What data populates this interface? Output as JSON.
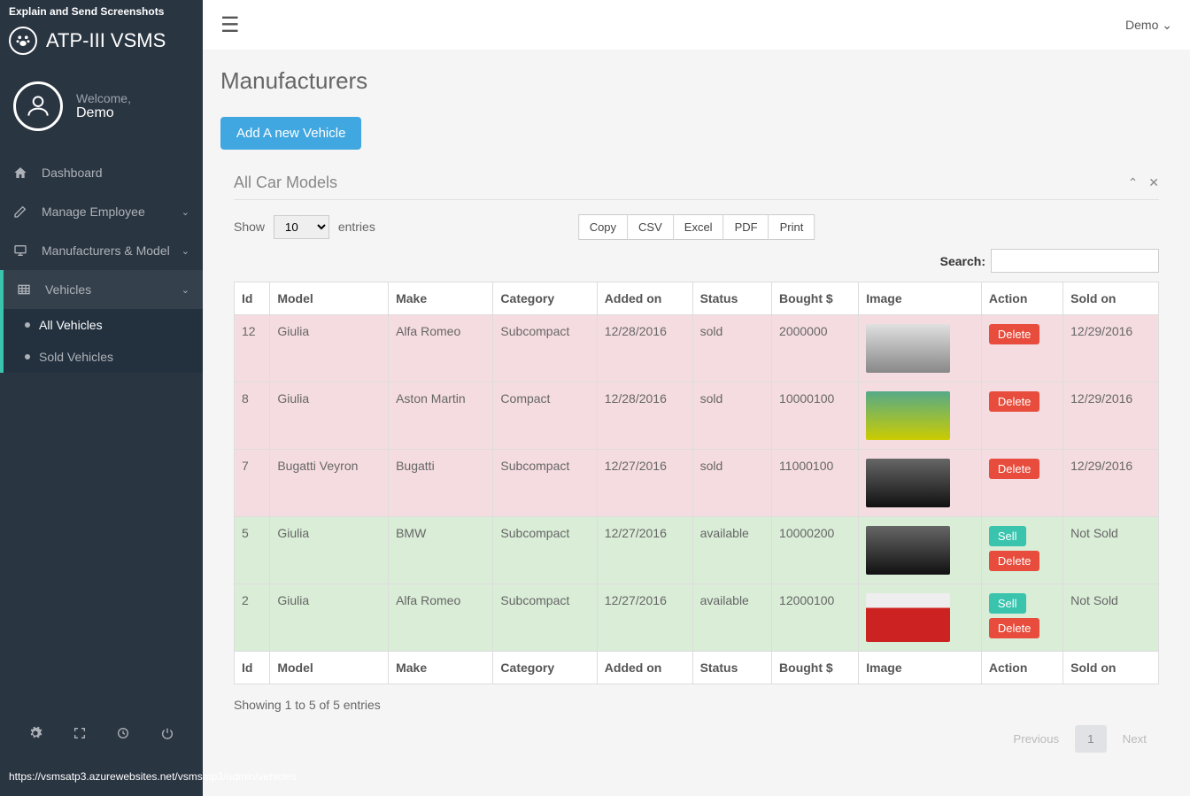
{
  "banner": "Explain and Send Screenshots",
  "app_name": "ATP-III VSMS",
  "welcome_label": "Welcome,",
  "user_name": "Demo",
  "nav": {
    "dashboard": "Dashboard",
    "manage_employee": "Manage Employee",
    "manufacturers_model": "Manufacturers & Model",
    "vehicles": "Vehicles",
    "all_vehicles": "All Vehicles",
    "sold_vehicles": "Sold Vehicles"
  },
  "topbar_user": "Demo",
  "page_title": "Manufacturers",
  "add_button": "Add A new Vehicle",
  "panel_title": "All Car Models",
  "entries": {
    "show": "Show",
    "value": "10",
    "label": "entries"
  },
  "export": {
    "copy": "Copy",
    "csv": "CSV",
    "excel": "Excel",
    "pdf": "PDF",
    "print": "Print"
  },
  "search_label": "Search:",
  "columns": {
    "id": "Id",
    "model": "Model",
    "make": "Make",
    "category": "Category",
    "added_on": "Added on",
    "status": "Status",
    "bought": "Bought $",
    "image": "Image",
    "action": "Action",
    "sold_on": "Sold on"
  },
  "actions": {
    "sell": "Sell",
    "delete": "Delete"
  },
  "rows": [
    {
      "id": "12",
      "model": "Giulia",
      "make": "Alfa Romeo",
      "category": "Subcompact",
      "added_on": "12/28/2016",
      "status": "sold",
      "bought": "2000000",
      "sold_on": "12/29/2016",
      "thumb": "silver"
    },
    {
      "id": "8",
      "model": "Giulia",
      "make": "Aston Martin",
      "category": "Compact",
      "added_on": "12/28/2016",
      "status": "sold",
      "bought": "10000100",
      "sold_on": "12/29/2016",
      "thumb": "yellow"
    },
    {
      "id": "7",
      "model": "Bugatti Veyron",
      "make": "Bugatti",
      "category": "Subcompact",
      "added_on": "12/27/2016",
      "status": "sold",
      "bought": "11000100",
      "sold_on": "12/29/2016",
      "thumb": "black"
    },
    {
      "id": "5",
      "model": "Giulia",
      "make": "BMW",
      "category": "Subcompact",
      "added_on": "12/27/2016",
      "status": "available",
      "bought": "10000200",
      "sold_on": "Not Sold",
      "thumb": "black"
    },
    {
      "id": "2",
      "model": "Giulia",
      "make": "Alfa Romeo",
      "category": "Subcompact",
      "added_on": "12/27/2016",
      "status": "available",
      "bought": "12000100",
      "sold_on": "Not Sold",
      "thumb": "red"
    }
  ],
  "table_info": "Showing 1 to 5 of 5 entries",
  "pagination": {
    "previous": "Previous",
    "page": "1",
    "next": "Next"
  },
  "status_url": "https://vsmsatp3.azurewebsites.net/vsmsatp3/admin/vehicles"
}
